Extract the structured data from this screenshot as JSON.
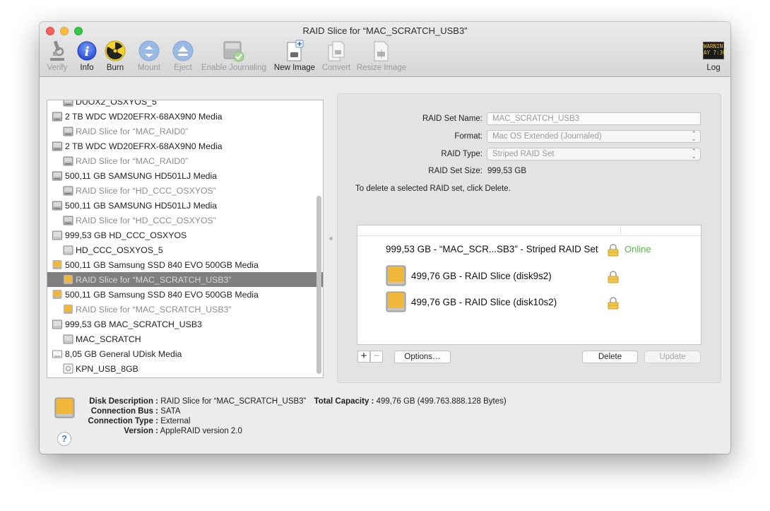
{
  "window": {
    "title": "RAID Slice for “MAC_SCRATCH_USB3”"
  },
  "toolbar": {
    "items": [
      {
        "label": "Verify",
        "icon": "microscope-icon",
        "enabled": false
      },
      {
        "label": "Info",
        "icon": "info-icon",
        "enabled": true
      },
      {
        "label": "Burn",
        "icon": "burn-radiation-icon",
        "enabled": true
      },
      {
        "label": "Mount",
        "icon": "mount-icon",
        "enabled": false
      },
      {
        "label": "Eject",
        "icon": "eject-icon",
        "enabled": false
      },
      {
        "label": "Enable Journaling",
        "icon": "journaling-icon",
        "enabled": false
      },
      {
        "label": "New Image",
        "icon": "new-image-icon",
        "enabled": true
      },
      {
        "label": "Convert",
        "icon": "convert-icon",
        "enabled": false
      },
      {
        "label": "Resize Image",
        "icon": "resize-image-icon",
        "enabled": false
      },
      {
        "label": "Log",
        "icon": "log-console-icon",
        "enabled": true
      }
    ],
    "log_icon_text": [
      "WARNIN",
      "AY 7:36"
    ]
  },
  "sidebar": {
    "items": [
      {
        "label": "DUOX2_OSXYOS_5",
        "kind": "vol",
        "icon": "hard-disk-icon"
      },
      {
        "label": "2 TB WDC WD20EFRX-68AX9N0 Media",
        "kind": "disk",
        "icon": "hard-disk-icon"
      },
      {
        "label": "RAID Slice for “MAC_RAID0”",
        "kind": "slice",
        "icon": "raid-slice-icon"
      },
      {
        "label": "2 TB WDC WD20EFRX-68AX9N0 Media",
        "kind": "disk",
        "icon": "hard-disk-icon"
      },
      {
        "label": "RAID Slice for “MAC_RAID0”",
        "kind": "slice",
        "icon": "raid-slice-icon"
      },
      {
        "label": "500,11 GB SAMSUNG HD501LJ Media",
        "kind": "disk",
        "icon": "hard-disk-icon"
      },
      {
        "label": "RAID Slice for “HD_CCC_OSXYOS”",
        "kind": "slice",
        "icon": "raid-slice-icon"
      },
      {
        "label": "500,11 GB SAMSUNG HD501LJ Media",
        "kind": "disk",
        "icon": "hard-disk-icon"
      },
      {
        "label": "RAID Slice for “HD_CCC_OSXYOS”",
        "kind": "slice",
        "icon": "raid-slice-icon"
      },
      {
        "label": "999,53 GB HD_CCC_OSXYOS",
        "kind": "disk",
        "icon": "raid-set-icon"
      },
      {
        "label": "HD_CCC_OSXYOS_5",
        "kind": "vol",
        "icon": "volume-icon"
      },
      {
        "label": "500,11 GB Samsung SSD 840 EVO 500GB Media",
        "kind": "disk",
        "icon": "ssd-icon"
      },
      {
        "label": "RAID Slice for “MAC_SCRATCH_USB3”",
        "kind": "slice",
        "icon": "ssd-slice-icon",
        "selected": true
      },
      {
        "label": "500,11 GB Samsung SSD 840 EVO 500GB Media",
        "kind": "disk",
        "icon": "ssd-icon"
      },
      {
        "label": "RAID Slice for “MAC_SCRATCH_USB3”",
        "kind": "slice",
        "icon": "ssd-slice-icon"
      },
      {
        "label": "999,53 GB MAC_SCRATCH_USB3",
        "kind": "disk",
        "icon": "raid-set-icon"
      },
      {
        "label": "MAC_SCRATCH",
        "kind": "vol",
        "icon": "volume-icon"
      },
      {
        "label": "8,05 GB General UDisk Media",
        "kind": "disk",
        "icon": "usb-disk-icon"
      },
      {
        "label": "KPN_USB_8GB",
        "kind": "vol",
        "icon": "usb-volume-icon"
      }
    ]
  },
  "raid": {
    "name_label": "RAID Set Name:",
    "name_value": "MAC_SCRATCH_USB3",
    "format_label": "Format:",
    "format_value": "Mac OS Extended (Journaled)",
    "type_label": "RAID Type:",
    "type_value": "Striped RAID Set",
    "size_label": "RAID Set Size:",
    "size_value": "999,53 GB",
    "note": "To delete a selected RAID set, click Delete.",
    "set_row": "999,53 GB - “MAC_SCR...SB3” - Striped RAID Set",
    "status": "Online",
    "slices": [
      {
        "label": "499,76 GB - RAID Slice (disk9s2)"
      },
      {
        "label": "499,76 GB - RAID Slice (disk10s2)"
      }
    ],
    "buttons": {
      "add": "+",
      "remove": "−",
      "options": "Options…",
      "delete": "Delete",
      "update": "Update"
    }
  },
  "info": {
    "disk_description_label": "Disk Description :",
    "disk_description": "RAID Slice for “MAC_SCRATCH_USB3”",
    "total_capacity_label": "Total Capacity :",
    "total_capacity": "499,76 GB (499.763.888.128 Bytes)",
    "connection_bus_label": "Connection Bus :",
    "connection_bus": "SATA",
    "connection_type_label": "Connection Type :",
    "connection_type": "External",
    "version_label": "Version :",
    "version": "AppleRAID version 2.0",
    "help": "?"
  },
  "colors": {
    "online": "#54b948",
    "selection": "#7f7f7f",
    "ssd": "#f0b73a"
  }
}
